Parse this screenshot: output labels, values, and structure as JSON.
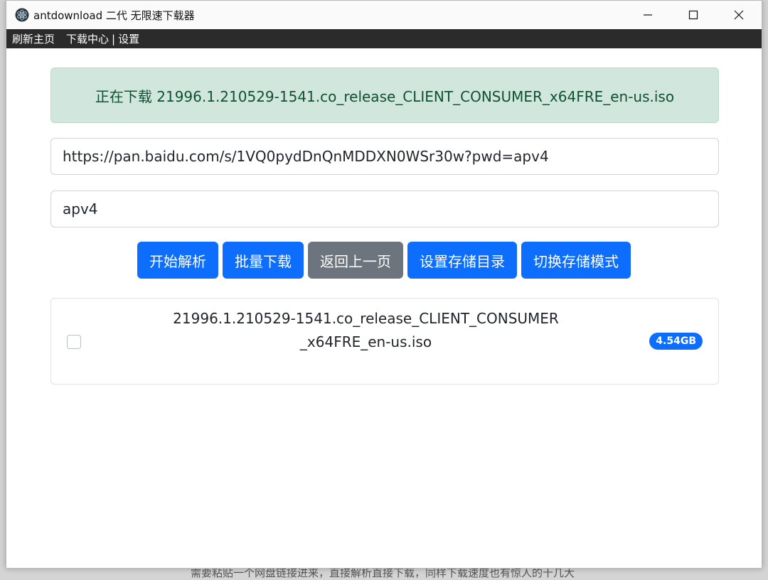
{
  "window": {
    "title": "antdownload 二代 无限速下载器",
    "controls": {
      "minimize": "─",
      "maximize": "☐",
      "close": "✕"
    }
  },
  "menu": {
    "items": [
      "刷新主页",
      "下载中心",
      "设置"
    ],
    "separator": "|"
  },
  "alert": {
    "text": "正在下载 21996.1.210529-1541.co_release_CLIENT_CONSUMER_x64FRE_en-us.iso",
    "color": "#0f5132",
    "background": "#d1e7dd"
  },
  "link_input": {
    "value": "https://pan.baidu.com/s/1VQ0pydDnQnMDDXN0WSr30w?pwd=apv4"
  },
  "password_input": {
    "value": "apv4"
  },
  "buttons": {
    "parse": "开始解析",
    "batch_download": "批量下载",
    "back": "返回上一页",
    "set_dir": "设置存储目录",
    "switch_mode": "切换存储模式"
  },
  "file": {
    "name": "21996.1.210529-1541.co_release_CLIENT_CONSUMER_x64FRE_en-us.iso",
    "size": "4.54GB",
    "checked": false
  },
  "background_caption": "需要粘贴一个网盘链接进来，直接解析直接下载，同样下载速度也有惊人的十几大",
  "colors": {
    "primary": "#0d6efd",
    "secondary": "#6c757d",
    "menubar": "#2b2b2b"
  }
}
